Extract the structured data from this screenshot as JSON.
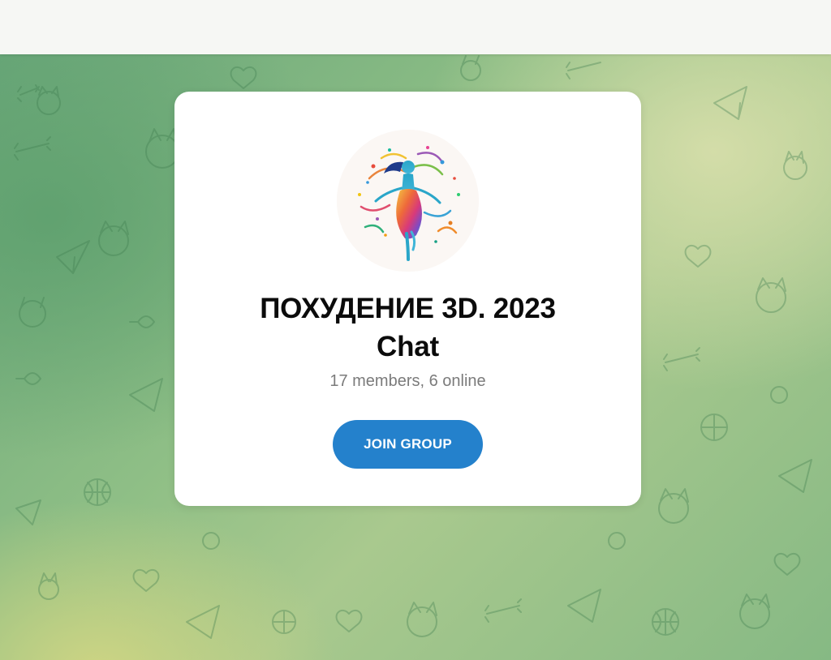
{
  "header": {},
  "group": {
    "title_line1": "ПОХУДЕНИЕ 3D. 2023",
    "title_line2": "Chat",
    "members_text": "17 members, 6 online",
    "avatar_icon": "dancing-woman-rainbow-avatar"
  },
  "actions": {
    "join_label": "JOIN GROUP"
  },
  "colors": {
    "accent": "#2481cc",
    "card_bg": "#ffffff",
    "topbar_bg": "#f6f7f4",
    "background_green": "#86b984"
  }
}
